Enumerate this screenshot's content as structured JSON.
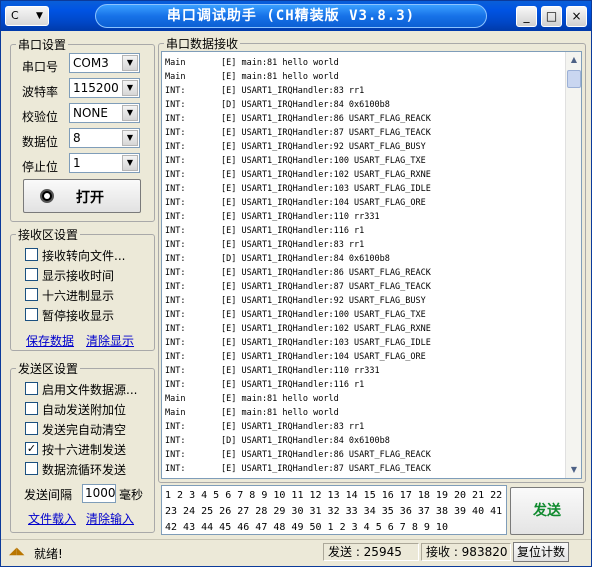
{
  "window": {
    "title": "串口调试助手 (CH精装版 V3.8.3)",
    "sysmenu_label": "C",
    "min": "_",
    "max": "□",
    "close": "×"
  },
  "serial": {
    "group_title": "串口设置",
    "port_label": "串口号",
    "port_value": "COM3",
    "baud_label": "波特率",
    "baud_value": "115200",
    "parity_label": "校验位",
    "parity_value": "NONE",
    "databits_label": "数据位",
    "databits_value": "8",
    "stopbits_label": "停止位",
    "stopbits_value": "1",
    "open_button": "打开"
  },
  "recv_settings": {
    "group_title": "接收区设置",
    "options": [
      {
        "label": "接收转向文件...",
        "checked": false
      },
      {
        "label": "显示接收时间",
        "checked": false
      },
      {
        "label": "十六进制显示",
        "checked": false
      },
      {
        "label": "暂停接收显示",
        "checked": false
      }
    ],
    "save_link": "保存数据",
    "clear_link": "清除显示"
  },
  "send_settings": {
    "group_title": "发送区设置",
    "options": [
      {
        "label": "启用文件数据源...",
        "checked": false
      },
      {
        "label": "自动发送附加位",
        "checked": false
      },
      {
        "label": "发送完自动清空",
        "checked": false
      },
      {
        "label": "按十六进制发送",
        "checked": true
      },
      {
        "label": "数据流循环发送",
        "checked": false
      }
    ],
    "interval_label": "发送间隔",
    "interval_value": "1000",
    "interval_unit": "毫秒",
    "load_file_link": "文件载入",
    "clear_input_link": "清除输入"
  },
  "recv_panel": {
    "title": "串口数据接收",
    "lines": [
      [
        "Main",
        "[E] main:81 hello world"
      ],
      [
        "Main",
        "[E] main:81 hello world"
      ],
      [
        "INT:",
        "[E] USART1_IRQHandler:83 rr1"
      ],
      [
        "INT:",
        "[D] USART1_IRQHandler:84 0x6100b8"
      ],
      [
        "INT:",
        "[E] USART1_IRQHandler:86 USART_FLAG_REACK"
      ],
      [
        "INT:",
        "[E] USART1_IRQHandler:87 USART_FLAG_TEACK"
      ],
      [
        "INT:",
        "[E] USART1_IRQHandler:92 USART_FLAG_BUSY"
      ],
      [
        "INT:",
        "[E] USART1_IRQHandler:100 USART_FLAG_TXE"
      ],
      [
        "INT:",
        "[E] USART1_IRQHandler:102 USART_FLAG_RXNE"
      ],
      [
        "INT:",
        "[E] USART1_IRQHandler:103 USART_FLAG_IDLE"
      ],
      [
        "INT:",
        "[E] USART1_IRQHandler:104 USART_FLAG_ORE"
      ],
      [
        "INT:",
        "[E] USART1_IRQHandler:110 rr331"
      ],
      [
        "INT:",
        "[E] USART1_IRQHandler:116 r1"
      ],
      [
        "INT:",
        "[E] USART1_IRQHandler:83 rr1"
      ],
      [
        "INT:",
        "[D] USART1_IRQHandler:84 0x6100b8"
      ],
      [
        "INT:",
        "[E] USART1_IRQHandler:86 USART_FLAG_REACK"
      ],
      [
        "INT:",
        "[E] USART1_IRQHandler:87 USART_FLAG_TEACK"
      ],
      [
        "INT:",
        "[E] USART1_IRQHandler:92 USART_FLAG_BUSY"
      ],
      [
        "INT:",
        "[E] USART1_IRQHandler:100 USART_FLAG_TXE"
      ],
      [
        "INT:",
        "[E] USART1_IRQHandler:102 USART_FLAG_RXNE"
      ],
      [
        "INT:",
        "[E] USART1_IRQHandler:103 USART_FLAG_IDLE"
      ],
      [
        "INT:",
        "[E] USART1_IRQHandler:104 USART_FLAG_ORE"
      ],
      [
        "INT:",
        "[E] USART1_IRQHandler:110 rr331"
      ],
      [
        "INT:",
        "[E] USART1_IRQHandler:116 r1"
      ],
      [
        "Main",
        "[E] main:81 hello world"
      ],
      [
        "Main",
        "[E] main:81 hello world"
      ],
      [
        "INT:",
        "[E] USART1_IRQHandler:83 rr1"
      ],
      [
        "INT:",
        "[D] USART1_IRQHandler:84 0x6100b8"
      ],
      [
        "INT:",
        "[E] USART1_IRQHandler:86 USART_FLAG_REACK"
      ],
      [
        "INT:",
        "[E] USART1_IRQHandler:87 USART_FLAG_TEACK"
      ]
    ]
  },
  "send_panel": {
    "text": "1 2 3 4 5 6 7 8 9 10 11 12 13 14 15 16 17 18 19 20 21 22 23 24 25 26 27 28 29 30 31 32 33 34 35 36 37 38 39 40 41 42 43 44 45 46 47 48 49 50 1 2 3 4 5 6 7 8 9 10",
    "send_button": "发送"
  },
  "status": {
    "message": "就绪!",
    "sent_label": "发送 : 25945",
    "recv_label": "接收 : 983820",
    "reset_button": "复位计数"
  }
}
